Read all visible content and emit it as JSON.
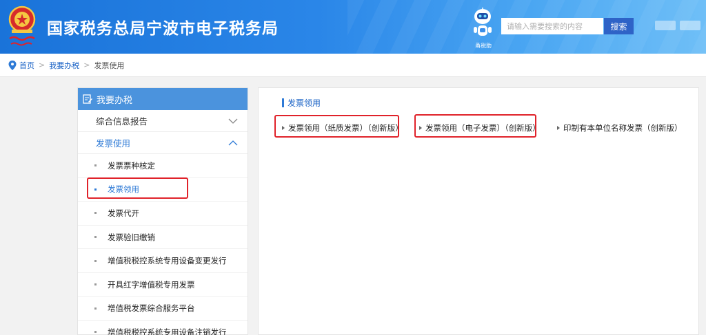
{
  "header": {
    "title": "国家税务总局宁波市电子税务局",
    "robot_label": "甬税助",
    "search_placeholder": "请输入需要搜索的内容",
    "search_button": "搜索"
  },
  "breadcrumb": {
    "home": "首页",
    "level1": "我要办税",
    "current": "发票使用",
    "separator": ">"
  },
  "sidebar": {
    "header": "我要办税",
    "categories": [
      {
        "label": "综合信息报告"
      },
      {
        "label": "发票使用"
      }
    ],
    "items": [
      {
        "label": "发票票种核定"
      },
      {
        "label": "发票领用"
      },
      {
        "label": "发票代开"
      },
      {
        "label": "发票验旧缴销"
      },
      {
        "label": "增值税税控系统专用设备变更发行"
      },
      {
        "label": "开具红字增值税专用发票"
      },
      {
        "label": "增值税发票综合服务平台"
      },
      {
        "label": "增值税税控系统专用设备注销发行"
      }
    ]
  },
  "main": {
    "section_title": "发票领用",
    "links": [
      {
        "label": "发票领用（纸质发票）（创新版）"
      },
      {
        "label": "发票领用（电子发票）（创新版）"
      },
      {
        "label": "印制有本单位名称发票（创新版）"
      }
    ]
  },
  "colors": {
    "header_blue": "#1a73d9",
    "accent_blue": "#2e7ad6",
    "sidebar_header": "#4b93dd",
    "highlight_red": "#e0222a"
  }
}
